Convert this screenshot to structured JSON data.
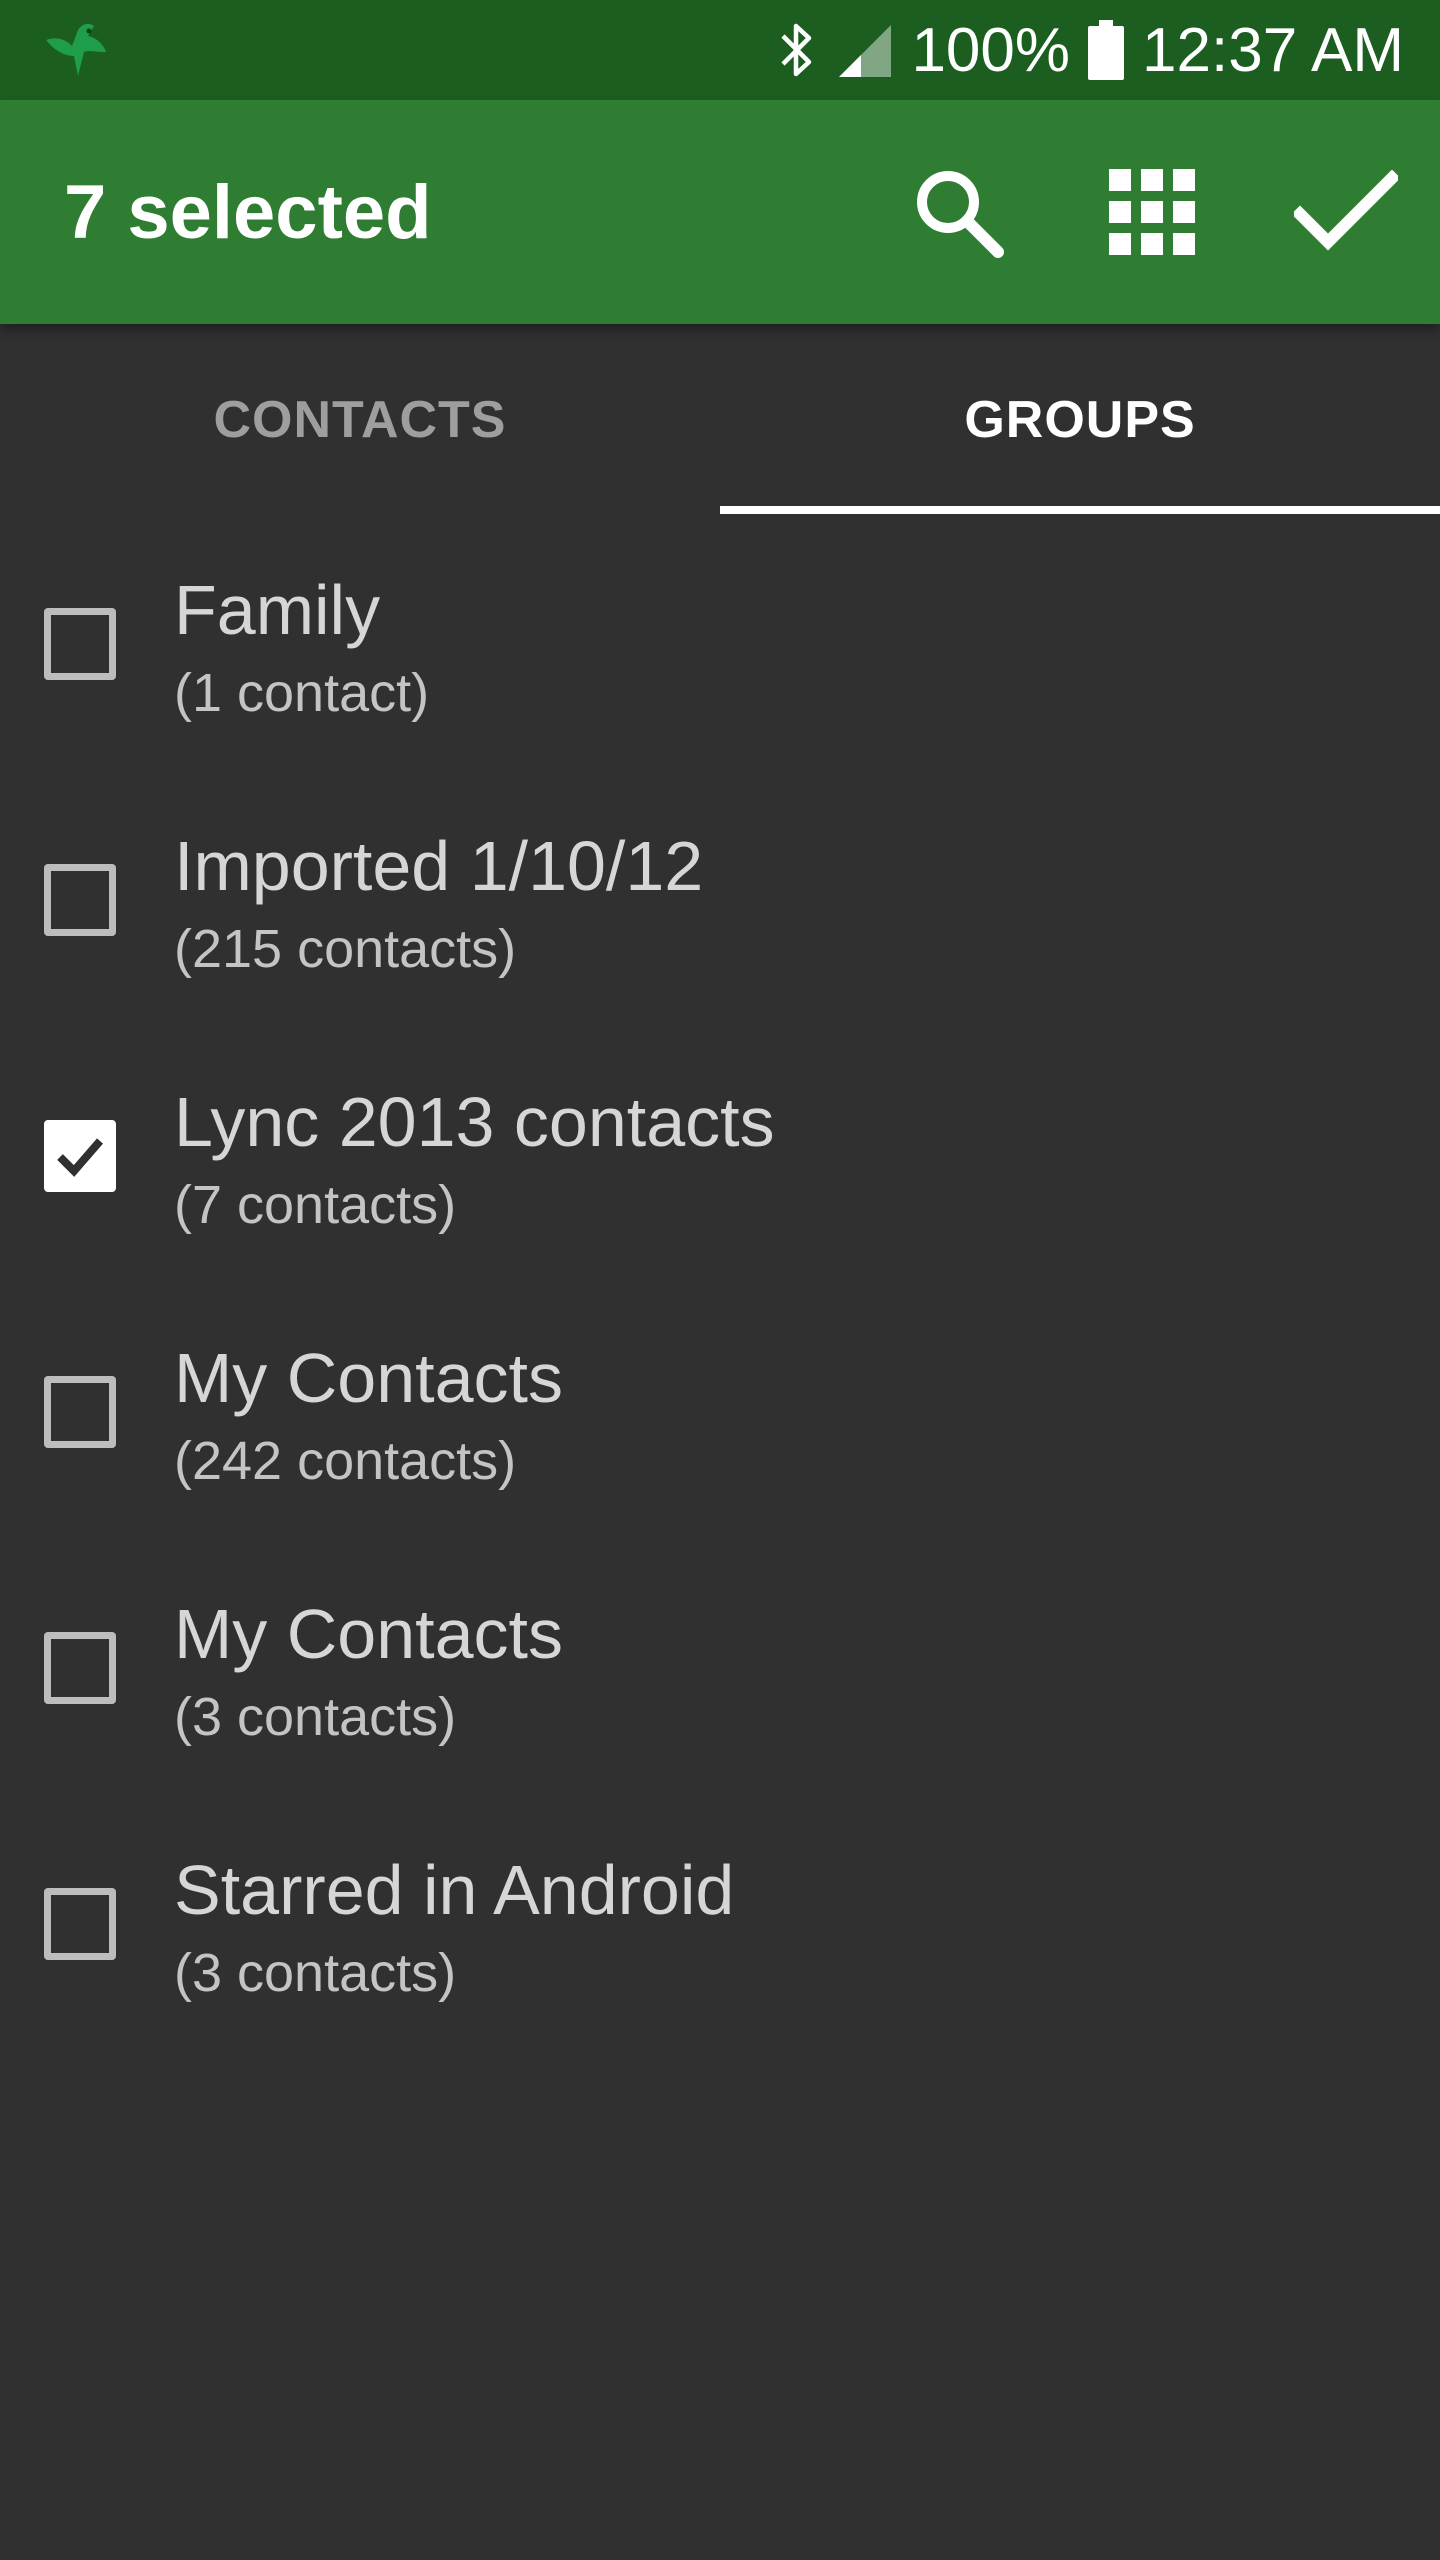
{
  "status_bar": {
    "app_icon": "hummingbird-icon",
    "bluetooth_icon": "bluetooth-icon",
    "signal_icon": "signal-icon",
    "battery_text": "100%",
    "battery_icon": "battery-icon",
    "time": "12:37 AM"
  },
  "app_bar": {
    "title": "7 selected",
    "actions": [
      "search-icon",
      "grid-icon",
      "check-icon"
    ],
    "color": "#2e7d32"
  },
  "tabs": [
    {
      "label": "CONTACTS",
      "selected": false
    },
    {
      "label": "GROUPS",
      "selected": true
    }
  ],
  "groups": [
    {
      "name": "Family",
      "count": "(1 contact)",
      "checked": false
    },
    {
      "name": "Imported 1/10/12",
      "count": "(215 contacts)",
      "checked": false
    },
    {
      "name": "Lync 2013 contacts",
      "count": "(7 contacts)",
      "checked": true
    },
    {
      "name": "My Contacts",
      "count": "(242 contacts)",
      "checked": false
    },
    {
      "name": "My Contacts",
      "count": "(3 contacts)",
      "checked": false
    },
    {
      "name": "Starred in Android",
      "count": "(3 contacts)",
      "checked": false
    }
  ]
}
